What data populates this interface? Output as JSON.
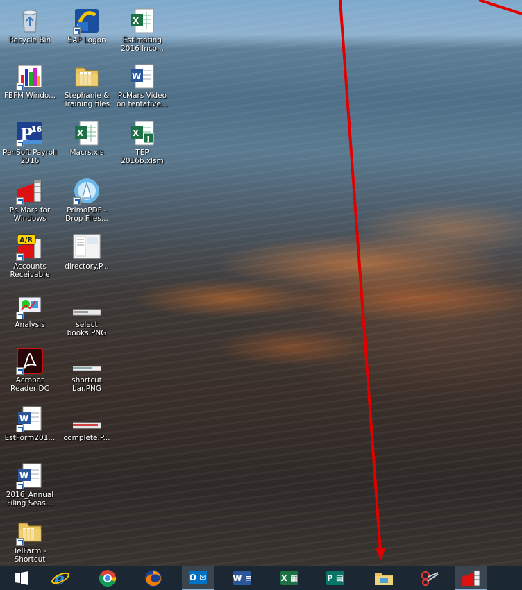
{
  "desktop": {
    "icons": [
      {
        "label": "Recycle Bin",
        "icon": "recycle-bin-icon"
      },
      {
        "label": "SAP Logon",
        "icon": "sap-logon-icon"
      },
      {
        "label": "Estimating 2016 Inco...",
        "icon": "excel-file-icon"
      },
      {
        "label": "FBFM Windo...",
        "icon": "fbfm-icon"
      },
      {
        "label": "Stephanie & Training files",
        "icon": "folder-icon"
      },
      {
        "label": "PcMars Video on tentative...",
        "icon": "word-file-icon"
      },
      {
        "label": "PenSoft Payroll 2016",
        "icon": "pensoft-icon"
      },
      {
        "label": "Macrs.xls",
        "icon": "excel-file-icon"
      },
      {
        "label": "TEP 2016b.xlsm",
        "icon": "excel-macro-file-icon"
      },
      {
        "label": "Pc Mars for Windows",
        "icon": "pcmars-icon"
      },
      {
        "label": "PrimoPDF - Drop Files...",
        "icon": "primopdf-icon"
      },
      {
        "label": "Accounts Receivable",
        "icon": "accounts-receivable-icon"
      },
      {
        "label": "directory.P...",
        "icon": "png-thumbnail-icon"
      },
      {
        "label": "Analysis",
        "icon": "analysis-icon"
      },
      {
        "label": "select books.PNG",
        "icon": "png-thumbnail-icon"
      },
      {
        "label": "Acrobat Reader DC",
        "icon": "acrobat-icon"
      },
      {
        "label": "shortcut bar.PNG",
        "icon": "png-thumbnail-icon"
      },
      {
        "label": "EstForm201...",
        "icon": "word-file-icon"
      },
      {
        "label": "complete.P...",
        "icon": "png-thumbnail-icon"
      },
      {
        "label": "2016_Annual Filing Seas...",
        "icon": "word-file-icon"
      },
      {
        "label": "TelFarm - Shortcut",
        "icon": "folder-icon"
      }
    ]
  },
  "taskbar": {
    "items": [
      {
        "name": "start-button",
        "icon": "windows-logo-icon"
      },
      {
        "name": "internet-explorer",
        "icon": "internet-explorer-icon"
      },
      {
        "name": "chrome",
        "icon": "chrome-icon"
      },
      {
        "name": "firefox",
        "icon": "firefox-icon"
      },
      {
        "name": "outlook",
        "icon": "outlook-icon",
        "glyph": "O"
      },
      {
        "name": "word",
        "icon": "word-icon",
        "glyph": "W"
      },
      {
        "name": "excel",
        "icon": "excel-icon",
        "glyph": "X"
      },
      {
        "name": "publisher",
        "icon": "publisher-icon",
        "glyph": "P"
      },
      {
        "name": "file-explorer",
        "icon": "file-explorer-icon"
      },
      {
        "name": "snipping-tool",
        "icon": "snipping-tool-icon"
      },
      {
        "name": "pc-mars",
        "icon": "pcmars-icon"
      }
    ]
  },
  "colors": {
    "annotation_arrow": "#e00000",
    "taskbar_bg": "#1b2733",
    "excel_green": "#1e7145",
    "word_blue": "#2b579a",
    "outlook_blue": "#0072c6",
    "publisher_teal": "#077568"
  }
}
